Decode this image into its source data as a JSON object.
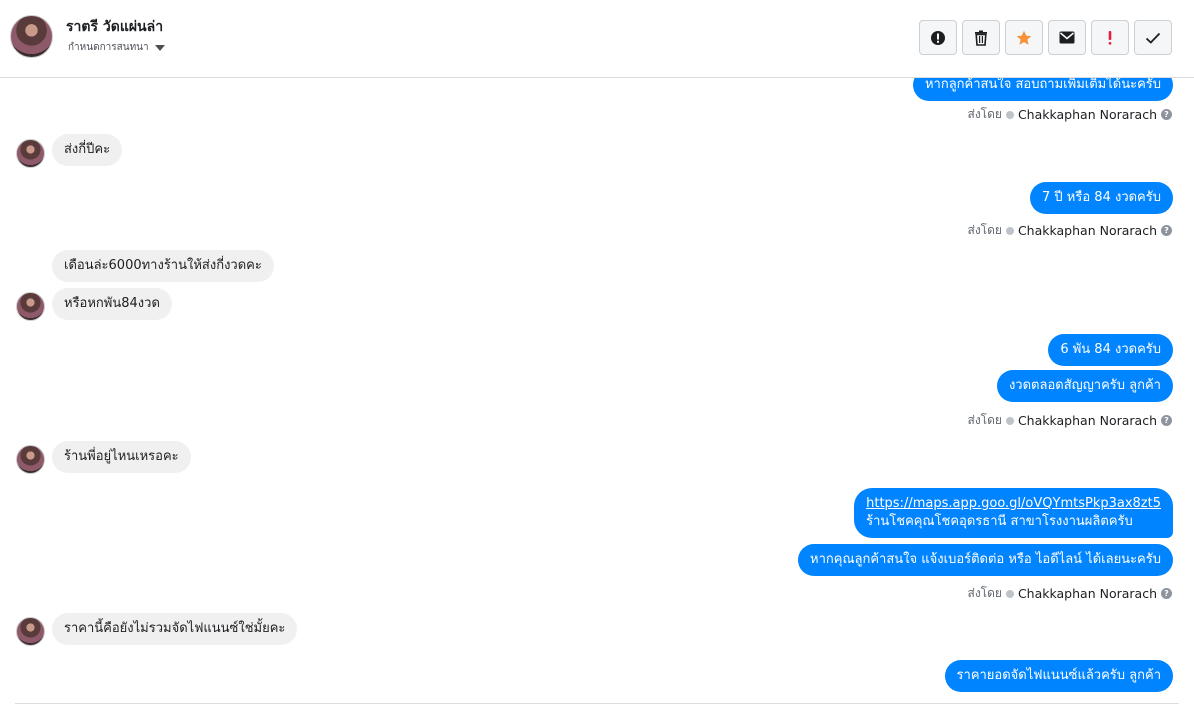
{
  "header": {
    "contact_name": "ราตรี วัดแผ่นล่า",
    "subtitle": "กำหนดการสนทนา",
    "actions": [
      {
        "name": "report-icon",
        "label": "!"
      },
      {
        "name": "trash-icon",
        "label": ""
      },
      {
        "name": "star-icon",
        "label": ""
      },
      {
        "name": "mail-icon",
        "label": ""
      },
      {
        "name": "spam-icon",
        "label": "!"
      },
      {
        "name": "check-icon",
        "label": ""
      }
    ]
  },
  "colors": {
    "outgoing": "#0084ff",
    "incoming": "#f1f0f0",
    "star": "#f7923b",
    "spam": "#e41e3f"
  },
  "messages": {
    "m1": "หากลูกค้าสนใจ สอบถามเพิ่มเติมได้นะครับ",
    "m2": "ส่งกี่ปีคะ",
    "m3": "7 ปี หรือ 84 งวดครับ",
    "m4": "เดือนล่ะ6000ทางร้านให้ส่งกี่งวดคะ",
    "m5": "หรือหกพัน84งวด",
    "m6": "6 พัน 84 งวดครับ",
    "m7": "งวดตลอดสัญญาครับ ลูกค้า",
    "m8": "ร้านพี่อยู่ไหนเหรอคะ",
    "m9_link": "https://maps.app.goo.gl/oVQYmtsPkp3ax8zt5",
    "m9_text": "ร้านโชคคุณโชคอุดรธานี สาขาโรงงานผลิตครับ",
    "m10": "หากคุณลูกค้าสนใจ แจ้งเบอร์ติดต่อ หรือ ไอดีไลน์ ได้เลยนะครับ",
    "m11": "ราคานี้คือยังไม่รวมจัดไฟแนนซ์ใช่มั้ยคะ",
    "m12": "ราคายอดจัดไฟแนนซ์แล้วครับ ลูกค้า"
  },
  "sent_by": {
    "label": "ส่งโดย",
    "author": "Chakkaphan Norarach",
    "help": "?"
  }
}
